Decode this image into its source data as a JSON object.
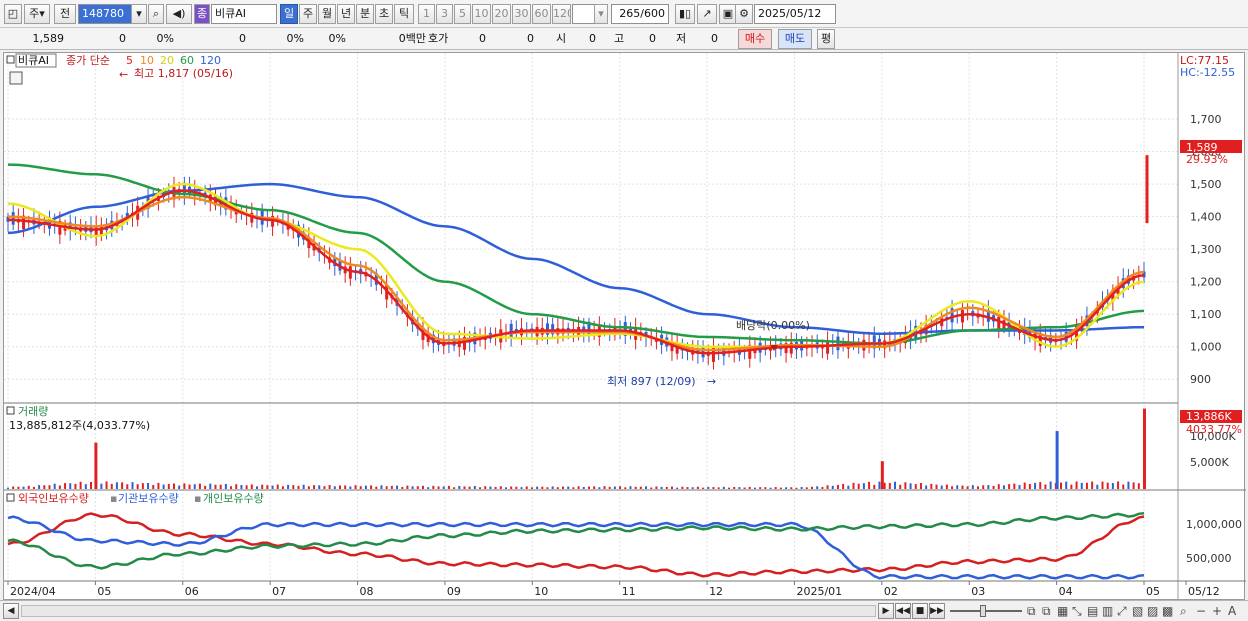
{
  "toolbar": {
    "market_label": "주",
    "prev_label": "전",
    "stock_code": "148780",
    "stock_name_badge": "종",
    "stock_name": "비큐AI",
    "period_tabs": [
      "일",
      "주",
      "월",
      "년",
      "분",
      "초",
      "틱"
    ],
    "interval_buttons": [
      "1",
      "3",
      "5",
      "10",
      "20",
      "30",
      "60",
      "120"
    ],
    "count_value": "265",
    "count_total": "/600",
    "date_value": "2025/05/12"
  },
  "quote": {
    "price": "1,589",
    "change": "0",
    "change_rate": "0%",
    "v1": "0",
    "v1_rate": "0%",
    "v2_rate": "0%",
    "amount": "0백만",
    "hoga_label": "호가",
    "hoga1": "0",
    "hoga2": "0",
    "open_label": "시",
    "open_value": "0",
    "high_label": "고",
    "high_value": "0",
    "low_label": "저",
    "low_value": "0",
    "buy_label": "매수",
    "sell_label": "매도",
    "avg_label": "평"
  },
  "price_panel": {
    "title": "비큐AI",
    "legend_prefix": "종가 단순",
    "ma_labels": [
      "5",
      "10",
      "20",
      "60",
      "120"
    ],
    "ma_colors": [
      "#e32020",
      "#f08a20",
      "#ece81c",
      "#239c46",
      "#2f5fd8"
    ],
    "lc_label": "LC:77.15",
    "hc_label": "HC:-12.55",
    "high_annotation": "최고 1,817 (05/16)",
    "low_annotation": "최저 897 (12/09)",
    "dividend_annotation": "배당락(0.00%)",
    "last_price_badge": "1,589",
    "last_rate_badge": "29.93%",
    "yaxis_ticks": [
      "1,700",
      "1,600",
      "1,500",
      "1,400",
      "1,300",
      "1,200",
      "1,100",
      "1,000",
      "900"
    ]
  },
  "volume_panel": {
    "title": "거래량",
    "value_line": "13,885,812주(4,033.77%)",
    "badge_value": "13,886K",
    "badge_rate": "4033.77%",
    "yaxis_ticks": [
      "10,000K",
      "5,000K"
    ]
  },
  "holding_panel": {
    "legend": [
      "외국인보유수량",
      "기관보유수량",
      "개인보유수량"
    ],
    "legend_colors": [
      "#d42020",
      "#2f5fd8",
      "#238a48"
    ],
    "yaxis_ticks": [
      "1,000,000",
      "500,000"
    ]
  },
  "xaxis_labels": [
    "2024/04",
    "05",
    "06",
    "07",
    "08",
    "09",
    "10",
    "11",
    "12",
    "2025/01",
    "02",
    "03",
    "04",
    "05",
    "05/12"
  ],
  "chart_data": [
    {
      "type": "line",
      "title": "비큐AI 종가 단순",
      "x": [
        "2024/04",
        "05",
        "06",
        "07",
        "08",
        "09",
        "10",
        "11",
        "12",
        "2025/01",
        "02",
        "03",
        "04",
        "05"
      ],
      "series": [
        {
          "name": "5",
          "values": [
            1390,
            1360,
            1480,
            1390,
            1230,
            1010,
            1050,
            1050,
            980,
            1000,
            1010,
            1100,
            1020,
            1220
          ]
        },
        {
          "name": "10",
          "values": [
            1400,
            1370,
            1460,
            1395,
            1250,
            1020,
            1045,
            1045,
            990,
            1005,
            1000,
            1120,
            1030,
            1230
          ]
        },
        {
          "name": "20",
          "values": [
            1440,
            1340,
            1500,
            1390,
            1300,
            1040,
            1025,
            1040,
            1000,
            1000,
            1010,
            1140,
            1000,
            1200
          ]
        },
        {
          "name": "60",
          "values": [
            1560,
            1530,
            1470,
            1420,
            1350,
            1200,
            1100,
            1060,
            1030,
            1020,
            1010,
            1050,
            1060,
            1110
          ]
        },
        {
          "name": "120",
          "values": [
            1350,
            1430,
            1480,
            1500,
            1460,
            1370,
            1270,
            1180,
            1100,
            1060,
            1040,
            1050,
            1050,
            1060
          ]
        }
      ],
      "ylim": [
        870,
        1780
      ]
    },
    {
      "type": "bar",
      "title": "거래량",
      "categories": [
        "2024/04",
        "05",
        "06",
        "07",
        "08",
        "09",
        "10",
        "11",
        "12",
        "2025/01",
        "02",
        "03",
        "04",
        "05/12"
      ],
      "values": [
        400,
        8000,
        900,
        700,
        600,
        500,
        400,
        450,
        350,
        300,
        4800,
        600,
        10000,
        13886
      ],
      "ylabel": "K"
    },
    {
      "type": "line",
      "title": "보유수량",
      "x": [
        "2024/04",
        "05",
        "06",
        "07",
        "08",
        "09",
        "10",
        "11",
        "12",
        "2025/01",
        "02",
        "03",
        "04",
        "05"
      ],
      "series": [
        {
          "name": "외국인보유수량",
          "values": [
            650000,
            1100000,
            800000,
            650000,
            500000,
            350000,
            330000,
            300000,
            180000,
            230000,
            260000,
            380000,
            420000,
            1050000
          ]
        },
        {
          "name": "기관보유수량",
          "values": [
            1050000,
            700000,
            650000,
            950000,
            950000,
            950000,
            950000,
            950000,
            950000,
            950000,
            150000,
            150000,
            150000,
            150000
          ]
        },
        {
          "name": "개인보유수량",
          "values": [
            700000,
            300000,
            500000,
            620000,
            650000,
            780000,
            850000,
            870000,
            900000,
            880000,
            920000,
            950000,
            1050000,
            1100000
          ]
        }
      ]
    }
  ]
}
